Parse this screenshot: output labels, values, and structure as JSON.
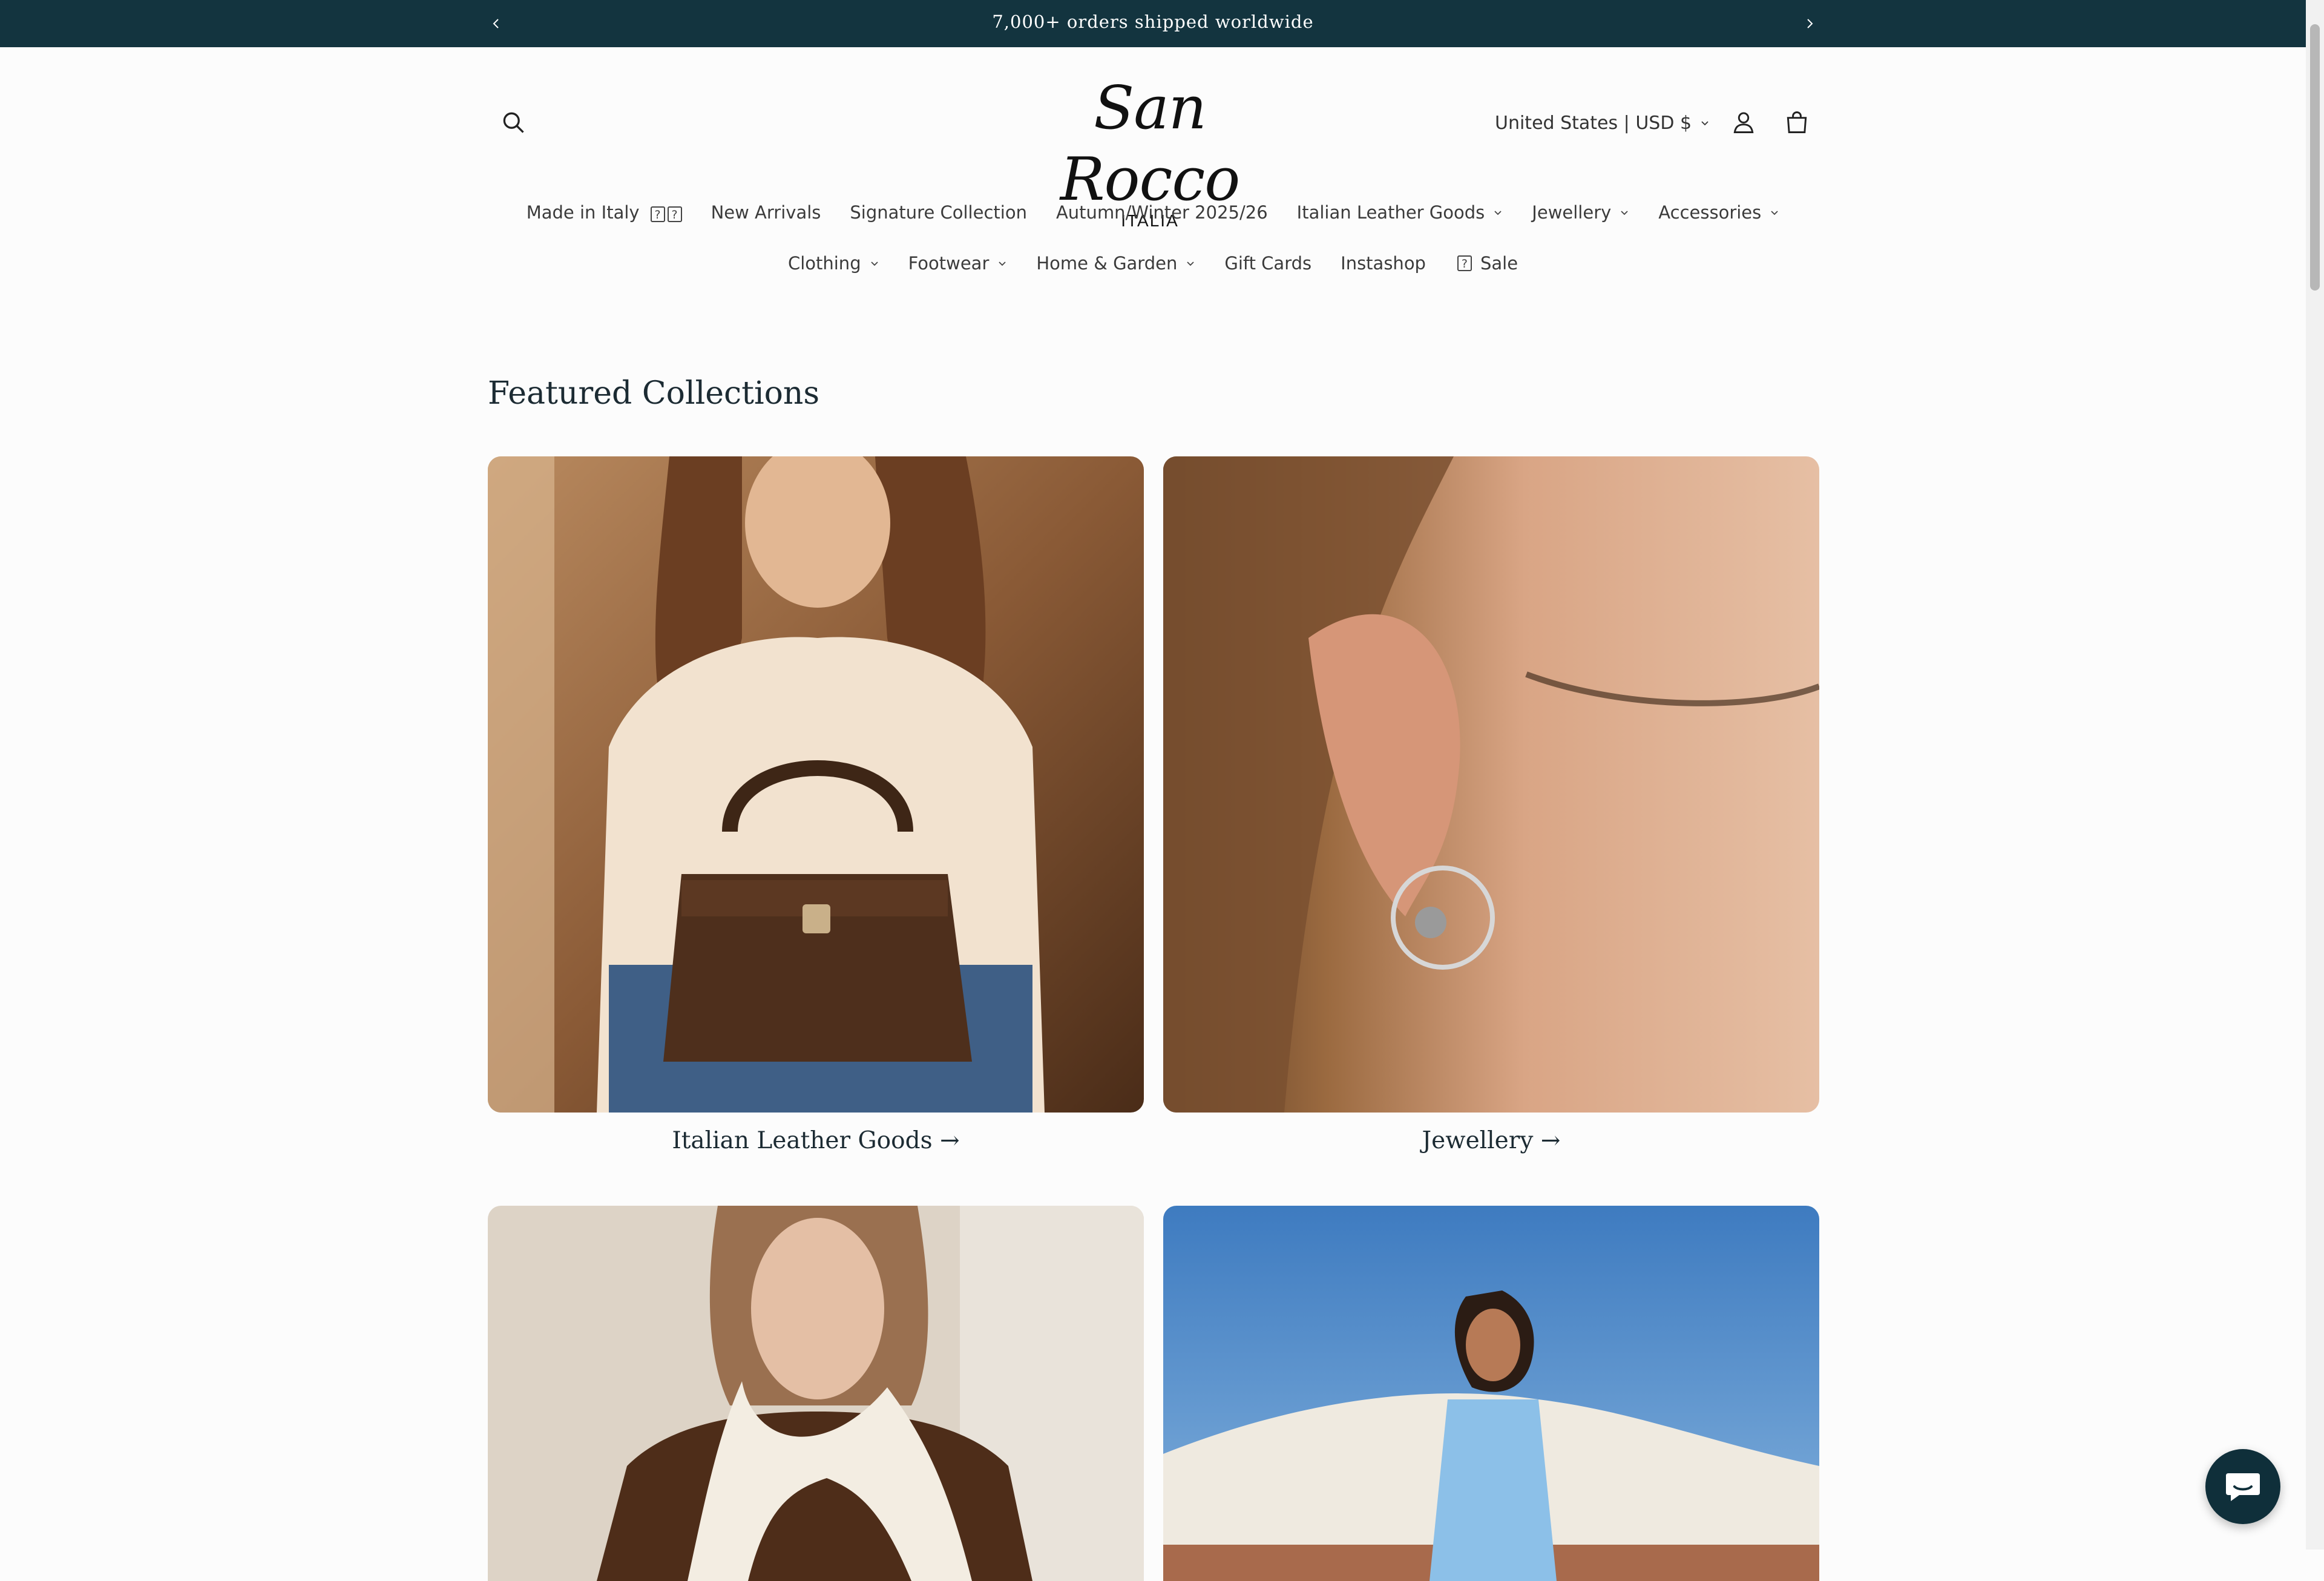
{
  "announcement": {
    "message": "7,000+ orders shipped worldwide",
    "bg_color": "#13343f"
  },
  "header": {
    "logo_script": "San Rocco",
    "logo_sub": "ITALIA",
    "locale": "United States | USD $",
    "icons": [
      "search-icon",
      "account-icon",
      "cart-icon"
    ]
  },
  "nav": {
    "row1": [
      {
        "label": "Made in Italy",
        "suffix": "??",
        "dropdown": false
      },
      {
        "label": "New Arrivals",
        "dropdown": false
      },
      {
        "label": "Signature Collection",
        "dropdown": false
      },
      {
        "label": "Autumn/Winter 2025/26",
        "dropdown": false
      },
      {
        "label": "Italian Leather Goods",
        "dropdown": true
      },
      {
        "label": "Jewellery",
        "dropdown": true
      },
      {
        "label": "Accessories",
        "dropdown": true
      }
    ],
    "row2": [
      {
        "label": "Clothing",
        "dropdown": true
      },
      {
        "label": "Footwear",
        "dropdown": true
      },
      {
        "label": "Home & Garden",
        "dropdown": true
      },
      {
        "label": "Gift Cards",
        "dropdown": false
      },
      {
        "label": "Instashop",
        "dropdown": false
      },
      {
        "label": "Sale",
        "prefix": "?",
        "dropdown": false
      }
    ]
  },
  "featured": {
    "title": "Featured Collections",
    "collections": [
      {
        "label": "Italian Leather Goods",
        "arrow": "→"
      },
      {
        "label": "Jewellery",
        "arrow": "→"
      }
    ]
  },
  "colors": {
    "accent": "#13343f",
    "chat_button": "#0f2f3a"
  }
}
